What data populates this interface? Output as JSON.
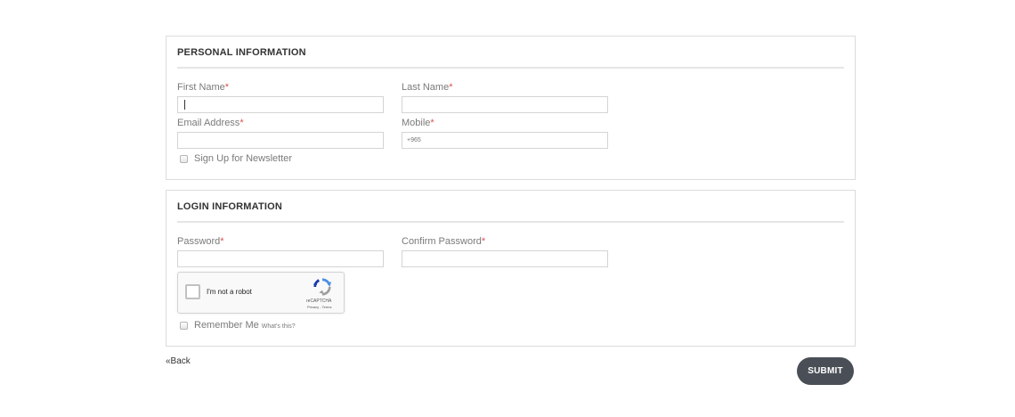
{
  "personal": {
    "legend": "PERSONAL INFORMATION",
    "first_name": {
      "label": "First Name",
      "value": ""
    },
    "last_name": {
      "label": "Last Name",
      "value": ""
    },
    "email": {
      "label": "Email Address",
      "value": ""
    },
    "mobile": {
      "label": "Mobile",
      "placeholder": "+965",
      "value": ""
    },
    "newsletter": {
      "label": "Sign Up for Newsletter",
      "checked": false
    }
  },
  "login": {
    "legend": "LOGIN INFORMATION",
    "password": {
      "label": "Password",
      "value": ""
    },
    "confirm_password": {
      "label": "Confirm Password",
      "value": ""
    },
    "recaptcha": {
      "label": "I'm not a robot",
      "brand": "reCAPTCHA",
      "terms": "Privacy - Terms",
      "icon": "recaptcha-logo-icon"
    },
    "remember_me": {
      "label": "Remember Me",
      "help_link": "What's this?",
      "checked": false
    }
  },
  "required_marker": "*",
  "actions": {
    "back_label": "«Back",
    "submit_label": "SUBMIT"
  },
  "colors": {
    "required": "#d9534f",
    "submit_bg": "#4a4f57",
    "border": "#dcdcdc"
  }
}
